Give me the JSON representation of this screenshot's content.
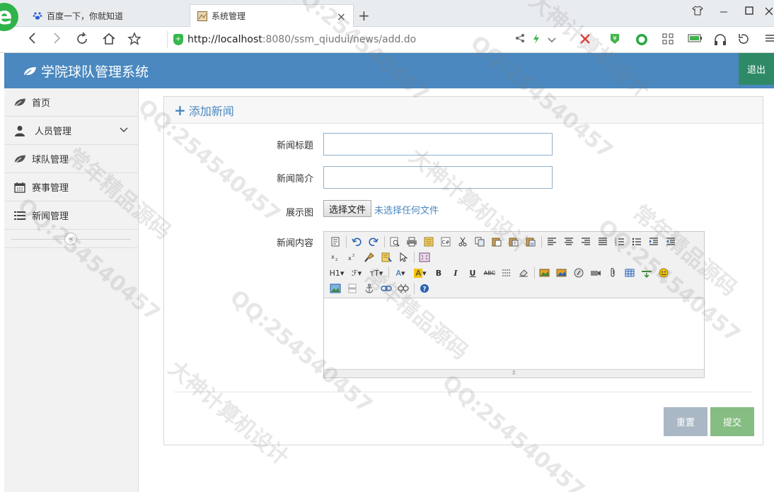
{
  "browser": {
    "tabs": [
      {
        "title": "百度一下，你就知道"
      },
      {
        "title": "系统管理"
      }
    ],
    "url_host": "http://localhost",
    "url_rest": ":8080/ssm_qiudui/news/add.do"
  },
  "app": {
    "title": "学院球队管理系统",
    "logout_label": "退出"
  },
  "sidebar": {
    "items": [
      {
        "label": "首页"
      },
      {
        "label": "人员管理"
      },
      {
        "label": "球队管理"
      },
      {
        "label": "赛事管理"
      },
      {
        "label": "新闻管理"
      }
    ]
  },
  "panel": {
    "title": "添加新闻"
  },
  "form": {
    "title_label": "新闻标题",
    "title_value": "",
    "summary_label": "新闻简介",
    "summary_value": "",
    "image_label": "展示图",
    "file_button": "选择文件",
    "file_status": "未选择任何文件",
    "content_label": "新闻内容"
  },
  "buttons": {
    "reset": "重置",
    "submit": "提交"
  },
  "colors": {
    "header": "#4a88bf",
    "logout": "#2e8a66",
    "reset": "#a9b8c4",
    "submit": "#86bd82"
  },
  "watermark": {
    "text1": "QQ:254540457",
    "text2": "大神计算机设计",
    "text3": "常年精品源码"
  }
}
